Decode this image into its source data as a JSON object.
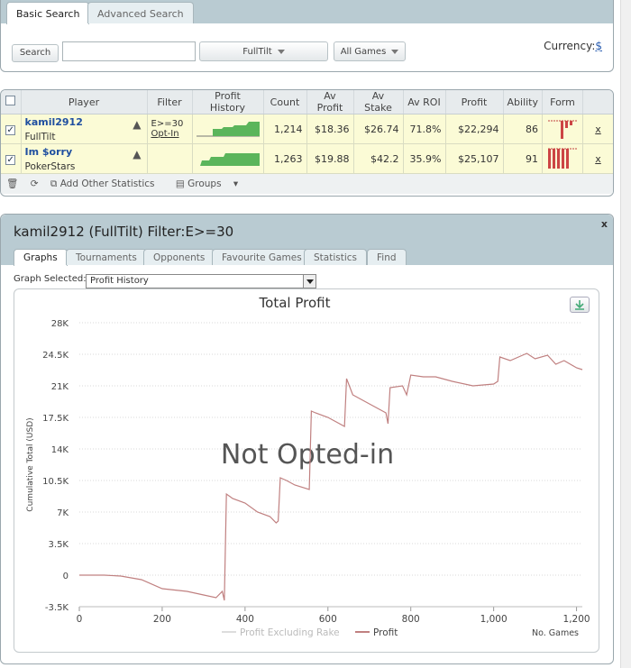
{
  "search": {
    "tabs": [
      "Basic Search",
      "Advanced Search"
    ],
    "search_button": "Search",
    "query_value": "",
    "network_select": "FullTilt",
    "games_select": "All Games",
    "currency_label": "Currency:",
    "currency_symbol": "$"
  },
  "table": {
    "headers": [
      "Player",
      "Filter",
      "Profit History",
      "Count",
      "Av Profit",
      "Av Stake",
      "Av ROI",
      "Profit",
      "Ability",
      "Form"
    ],
    "rows": [
      {
        "name": "kamil2912",
        "network": "FullTilt",
        "filter": "E>=30",
        "filter_link": "Opt-In",
        "count": "1,214",
        "av_profit": "$18.36",
        "av_stake": "$26.74",
        "av_roi": "71.8%",
        "profit": "$22,294",
        "ability": "86",
        "remove": "x"
      },
      {
        "name": "Im $orry",
        "network": "PokerStars",
        "filter": "",
        "filter_link": "",
        "count": "1,263",
        "av_profit": "$19.88",
        "av_stake": "$42.2",
        "av_roi": "35.9%",
        "profit": "$25,107",
        "ability": "91",
        "remove": "x"
      }
    ],
    "toolbar": {
      "add_stats": "Add Other Statistics",
      "groups": "Groups"
    }
  },
  "graph": {
    "title": "kamil2912 (FullTilt) Filter:E>=30",
    "close": "x",
    "tabs": [
      "Graphs",
      "Tournaments",
      "Opponents",
      "Favourite Games",
      "Statistics",
      "Find"
    ],
    "select_label": "Graph Selected:",
    "selected": "Profit History"
  },
  "chart_data": {
    "type": "line",
    "title": "Total Profit",
    "xlabel": "No. Games",
    "ylabel": "Cumulative Total (USD)",
    "watermark": "Not Opted-in",
    "xlim": [
      0,
      1214
    ],
    "ylim": [
      -3500,
      28000
    ],
    "x_ticks": [
      "0",
      "200",
      "400",
      "600",
      "800",
      "1,000",
      "1,200"
    ],
    "y_ticks": [
      "28K",
      "24.5K",
      "21K",
      "17.5K",
      "14K",
      "10.5K",
      "7K",
      "3.5K",
      "0",
      "-3.5K"
    ],
    "legend": [
      "Profit Excluding Rake",
      "Profit"
    ],
    "series": [
      {
        "name": "Profit",
        "color": "#c08080",
        "x": [
          0,
          60,
          100,
          150,
          200,
          260,
          300,
          330,
          345,
          350,
          355,
          370,
          400,
          430,
          460,
          475,
          480,
          485,
          500,
          520,
          555,
          560,
          570,
          600,
          620,
          640,
          645,
          660,
          700,
          740,
          745,
          750,
          780,
          790,
          800,
          830,
          860,
          900,
          950,
          1000,
          1010,
          1015,
          1040,
          1080,
          1100,
          1130,
          1150,
          1170,
          1200,
          1214
        ],
        "y": [
          0,
          0,
          -100,
          -500,
          -1500,
          -1800,
          -2200,
          -2500,
          -1800,
          -2800,
          9000,
          8500,
          8000,
          7000,
          6500,
          5800,
          6000,
          10800,
          10500,
          10000,
          9500,
          18200,
          18000,
          17500,
          17000,
          16500,
          21800,
          20000,
          19000,
          18000,
          16800,
          20800,
          21000,
          20000,
          22200,
          22000,
          22000,
          21500,
          21000,
          21200,
          21500,
          24200,
          23800,
          24600,
          24000,
          24400,
          23400,
          23800,
          23000,
          22800
        ]
      }
    ],
    "legend_position": "bottom",
    "grid": true
  }
}
